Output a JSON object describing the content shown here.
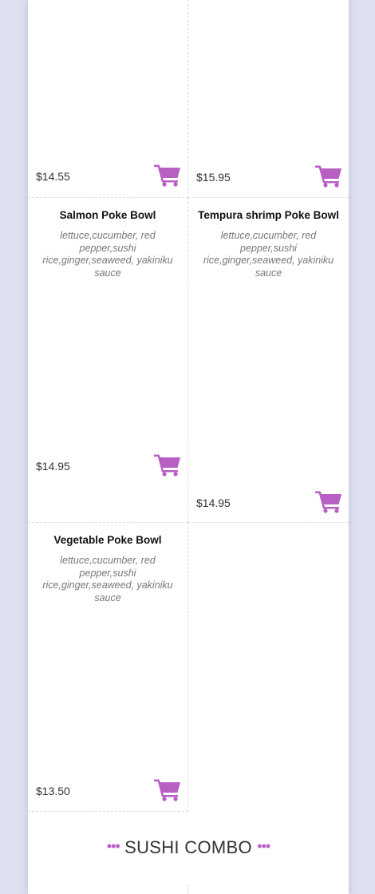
{
  "colors": {
    "accent": "#b85fc4",
    "background": "#dde1ef",
    "panel": "#ffffff"
  },
  "top_row": {
    "left_price": "$14.55",
    "right_price": "$15.95"
  },
  "items": [
    {
      "name": "Salmon Poke Bowl",
      "description": "lettuce,cucumber, red pepper,sushi rice,ginger,seaweed, yakiniku sauce",
      "price": "$14.95",
      "cart_icon": "shopping-cart-icon"
    },
    {
      "name": "Tempura shrimp Poke Bowl",
      "description": "lettuce,cucumber, red pepper,sushi rice,ginger,seaweed, yakiniku sauce",
      "price": "$14.95",
      "cart_icon": "shopping-cart-icon"
    },
    {
      "name": "Vegetable Poke Bowl",
      "description": "lettuce,cucumber, red pepper,sushi rice,ginger,seaweed, yakiniku sauce",
      "price": "$13.50",
      "cart_icon": "shopping-cart-icon"
    }
  ],
  "section": {
    "dots_left": "•••",
    "title": "SUSHI COMBO",
    "dots_right": "•••"
  }
}
